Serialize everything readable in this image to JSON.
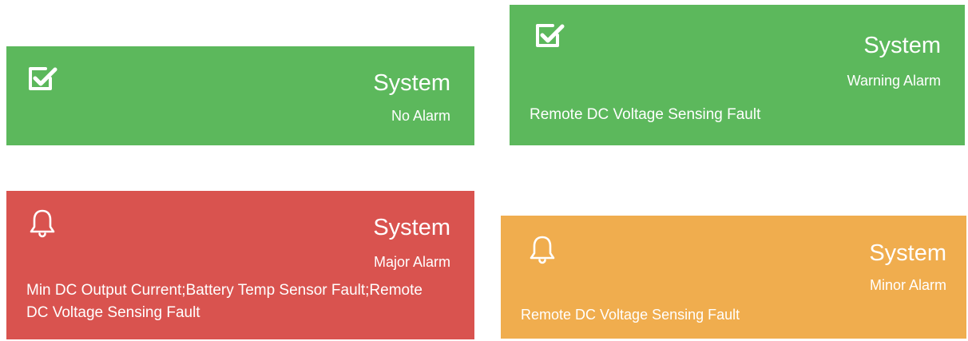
{
  "cards": [
    {
      "title": "System",
      "level": "No Alarm",
      "details": "",
      "icon": "check-square-icon",
      "color": "#5cb85c"
    },
    {
      "title": "System",
      "level": "Warning Alarm",
      "details": "Remote DC Voltage Sensing Fault",
      "icon": "check-square-icon",
      "color": "#5cb85c"
    },
    {
      "title": "System",
      "level": "Major Alarm",
      "details": "Min DC Output Current;Battery Temp Sensor Fault;Remote DC Voltage Sensing Fault",
      "icon": "bell-icon",
      "color": "#d9534f"
    },
    {
      "title": "System",
      "level": "Minor Alarm",
      "details": "Remote DC Voltage Sensing Fault",
      "icon": "bell-icon",
      "color": "#f0ad4e"
    }
  ]
}
